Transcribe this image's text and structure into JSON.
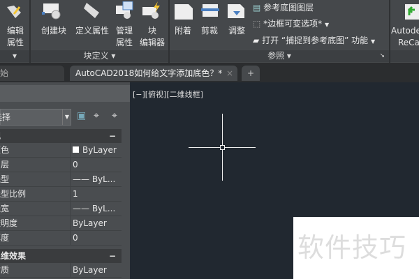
{
  "ribbon": {
    "edit_attr": "编辑\n属性",
    "edit_attr_1": "编辑",
    "edit_attr_2": "属性",
    "create_block": "创建块",
    "define_attr": "定义属性",
    "manage_attr_1": "管理",
    "manage_attr_2": "属性",
    "block_editor_1": "块",
    "block_editor_2": "编辑器",
    "attach": "附着",
    "clip": "剪裁",
    "adjust": "调整",
    "ref_layer": "参考底图图层",
    "frame_var": "*边框可变选项*",
    "snap": "打开 “捕捉到参考底图” 功能",
    "recap_1": "Autodesk",
    "recap_2": "ReCap",
    "panel_block_def": "块定义 ▾",
    "panel_reference": "参照 ▾"
  },
  "tabs": {
    "start": "开始",
    "doc": "AutoCAD2018如何给文字添加底色？*",
    "close": "×",
    "add": "+"
  },
  "palette": {
    "selector": "无选择",
    "sections": [
      {
        "title": "常规",
        "toggle": "−"
      },
      {
        "title": "三维效果",
        "toggle": "−"
      }
    ],
    "general": [
      {
        "k": "颜色",
        "v": "ByLayer"
      },
      {
        "k": "图层",
        "v": "0"
      },
      {
        "k": "线型",
        "v": "—— ByL..."
      },
      {
        "k": "线型比例",
        "v": "1"
      },
      {
        "k": "线宽",
        "v": "—— ByL..."
      },
      {
        "k": "透明度",
        "v": "ByLayer"
      },
      {
        "k": "厚度",
        "v": "0"
      }
    ],
    "effects": [
      {
        "k": "材质",
        "v": "ByLayer"
      }
    ]
  },
  "viewport": {
    "label": "[−][俯视][二维线框]"
  },
  "watermark": "软件技巧"
}
